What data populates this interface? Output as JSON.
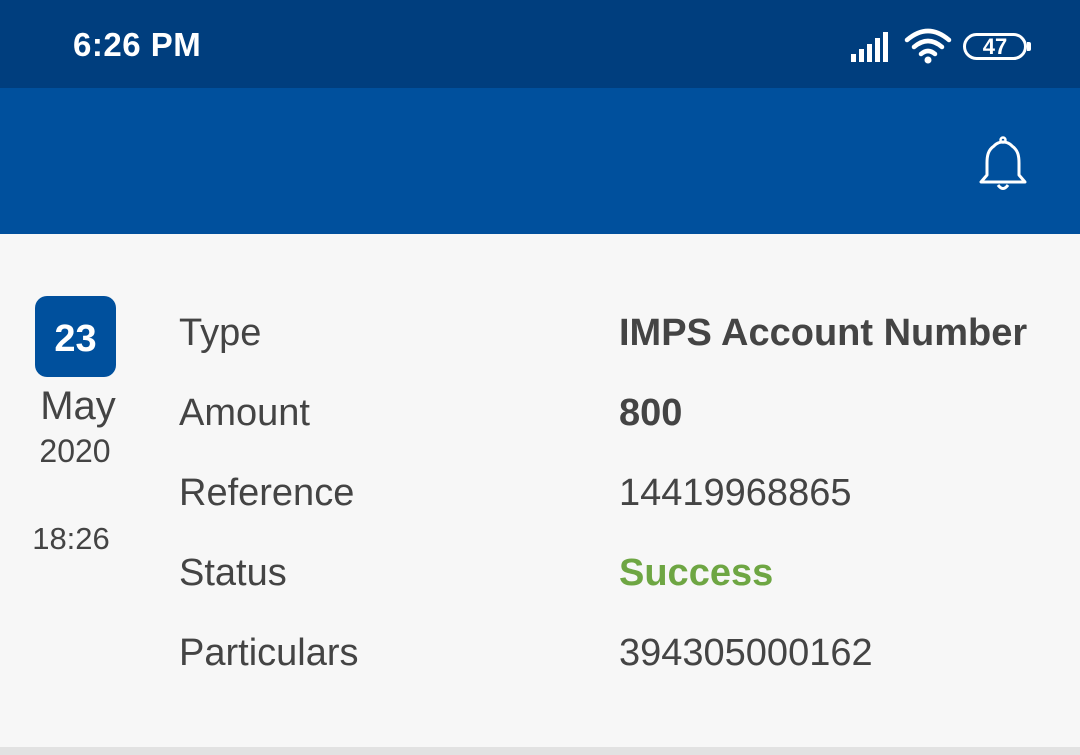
{
  "status_bar": {
    "time": "6:26 PM",
    "battery": "47",
    "icons": [
      "signal-icon",
      "wifi-icon",
      "battery-icon"
    ]
  },
  "app_bar": {
    "icons": [
      "bell-icon"
    ],
    "color": "#00509d"
  },
  "transaction": {
    "date": {
      "day": "23",
      "month": "May",
      "year": "2020",
      "time": "18:26"
    },
    "rows": [
      {
        "label": "Type",
        "value": "IMPS Account Number"
      },
      {
        "label": "Amount",
        "value": "800"
      },
      {
        "label": "Reference",
        "value": "14419968865"
      },
      {
        "label": "Status",
        "value": "Success"
      },
      {
        "label": "Particulars",
        "value": "394305000162"
      }
    ]
  },
  "colors": {
    "status_bar": "#003e7e",
    "accent": "#00509d",
    "success": "#6ea643",
    "text": "#444444",
    "background": "#f7f7f7"
  }
}
